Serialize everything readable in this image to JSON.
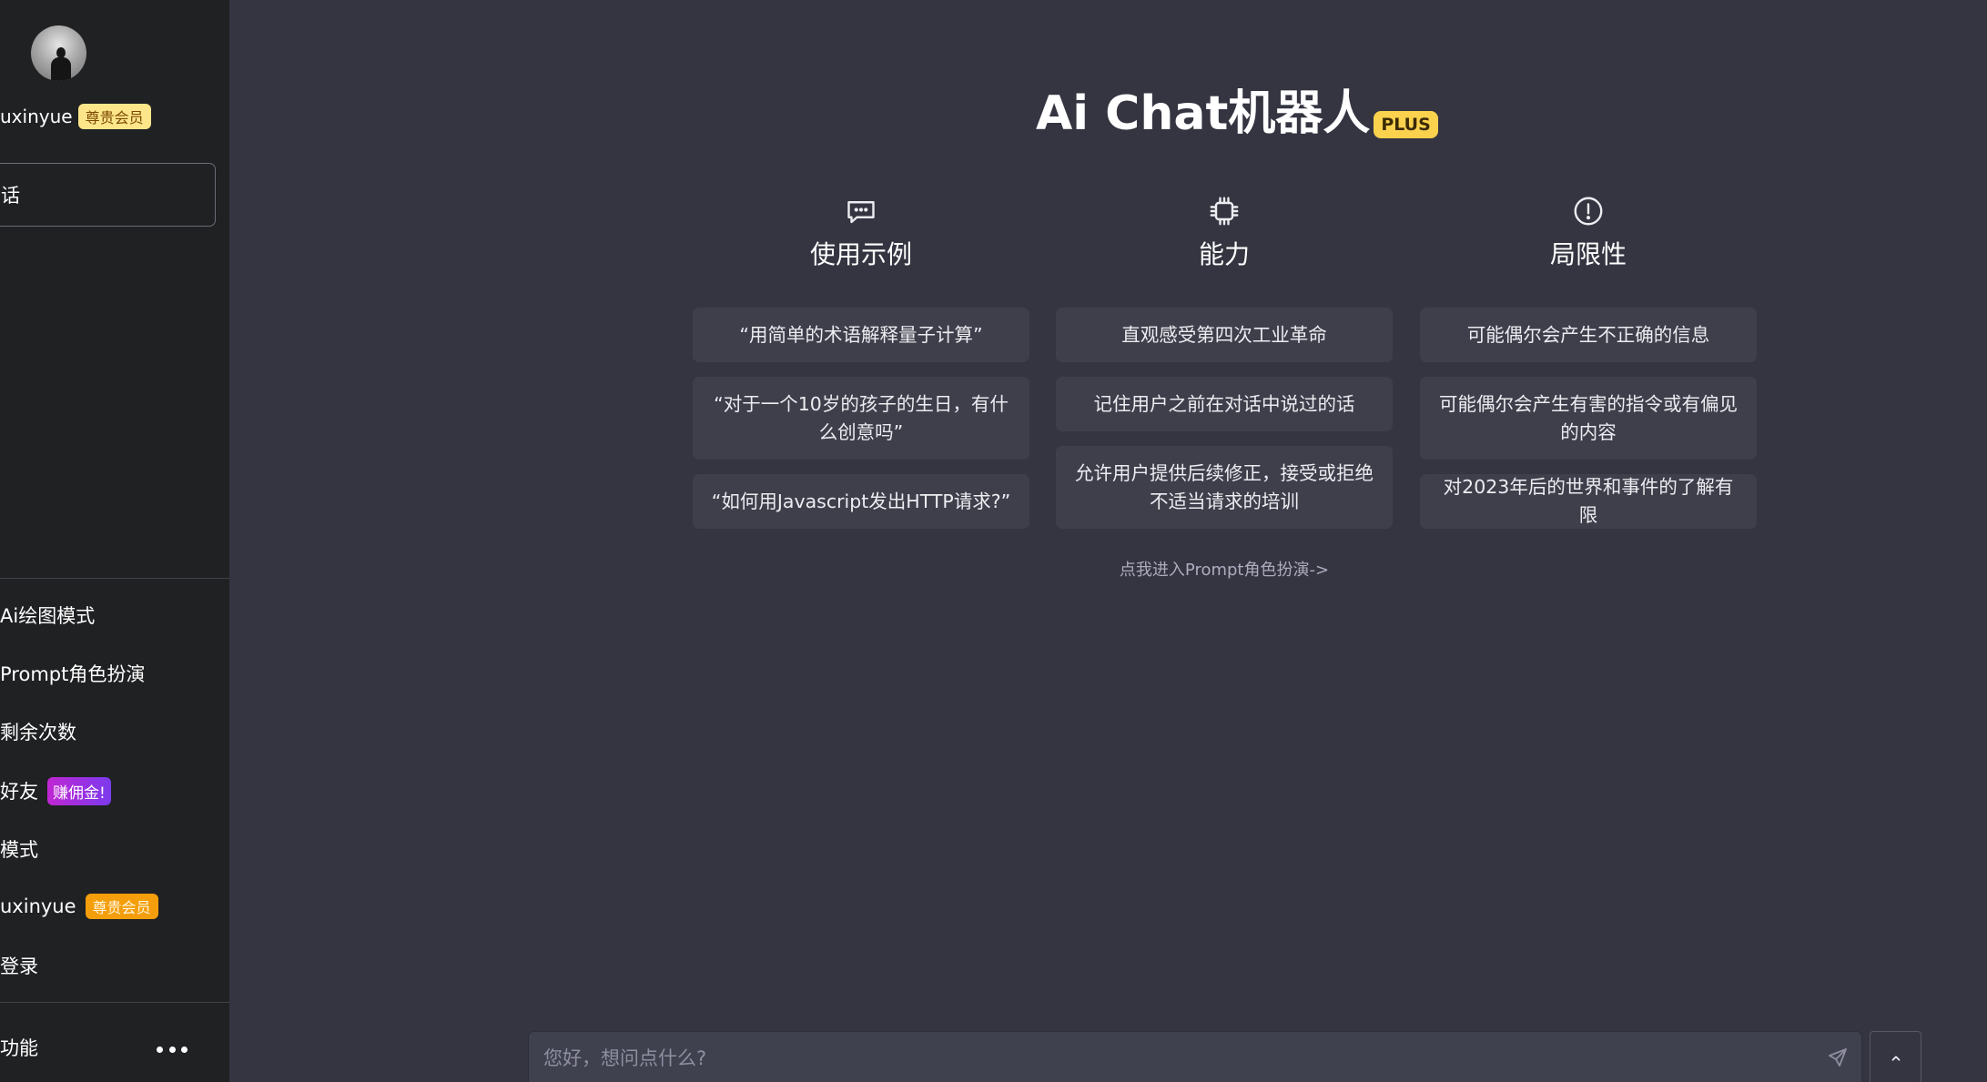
{
  "sidebar": {
    "user": {
      "name": "uxinyue",
      "badge": "尊贵会员"
    },
    "new_chat_label": "话",
    "menu": [
      {
        "label": "Ai绘图模式"
      },
      {
        "label": "Prompt角色扮演"
      },
      {
        "label": "剩余次数"
      },
      {
        "label": "好友",
        "badge": "赚佣金!"
      },
      {
        "label": "模式"
      },
      {
        "label": "uxinyue",
        "badge": "尊贵会员"
      },
      {
        "label": "登录"
      }
    ],
    "footer_label": "功能"
  },
  "main": {
    "title": "Ai Chat机器人",
    "title_badge": "PLUS",
    "columns": [
      {
        "icon": "chat-bubble-icon",
        "title": "使用示例",
        "cards": [
          "“用简单的术语解释量子计算”",
          "“对于一个10岁的孩子的生日，有什么创意吗”",
          "“如何用Javascript发出HTTP请求?”"
        ]
      },
      {
        "icon": "cpu-chip-icon",
        "title": "能力",
        "cards": [
          "直观感受第四次工业革命",
          "记住用户之前在对话中说过的话",
          "允许用户提供后续修正，接受或拒绝不适当请求的培训"
        ]
      },
      {
        "icon": "exclamation-circle-icon",
        "title": "局限性",
        "cards": [
          "可能偶尔会产生不正确的信息",
          "可能偶尔会产生有害的指令或有偏见的内容",
          "对2023年后的世界和事件的了解有限"
        ]
      }
    ],
    "prompt_link": "点我进入Prompt角色扮演->"
  },
  "input": {
    "placeholder": "您好，想问点什么?",
    "value": ""
  },
  "icons": {
    "send": "send-icon",
    "scroll": "chevron-up-icon",
    "more": "more-dots-icon"
  },
  "colors": {
    "background": "#343541",
    "sidebar": "#202123",
    "card": "#3e3f4b",
    "plus_badge": "#fbd24e",
    "vip_badge": "#fde68a"
  }
}
